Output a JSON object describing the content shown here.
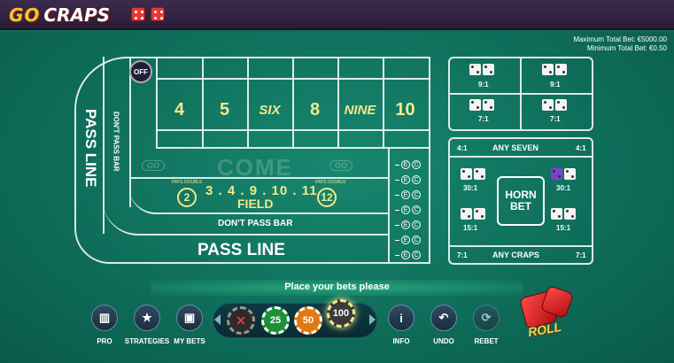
{
  "header": {
    "logo_go": "GO",
    "logo_craps": "CRAPS"
  },
  "limits": {
    "max_total_bet": "Maximum Total Bet: €5000.00",
    "min_total_bet": "Minimum Total Bet: €0.50"
  },
  "table": {
    "off_label": "OFF",
    "numbers": [
      "4",
      "5",
      "SIX",
      "8",
      "NINE",
      "10"
    ],
    "come_label": "COME",
    "go_badge": "GO",
    "field_numbers": "3 . 4 . 9 . 10 . 11 .",
    "field_label": "FIELD",
    "field_circle_left": "2",
    "field_circle_right": "12",
    "pays_double": "PAYS DOUBLE",
    "dont_pass_bar_h": "DON'T PASS BAR",
    "dont_pass_bar_v": "DON'T PASS BAR",
    "pass_line_h": "PASS LINE",
    "pass_line_v": "PASS LINE",
    "ec_e": "E",
    "ec_c": "C"
  },
  "props": {
    "hardways_odds": [
      "9:1",
      "9:1",
      "7:1",
      "7:1"
    ],
    "any_seven": "ANY SEVEN",
    "any_seven_odds_left": "4:1",
    "any_seven_odds_right": "4:1",
    "horn_bet": "HORN BET",
    "horn_odds": [
      "30:1",
      "30:1",
      "15:1",
      "15:1"
    ],
    "any_craps": "ANY CRAPS",
    "any_craps_odds_left": "7:1",
    "any_craps_odds_right": "7:1"
  },
  "status": {
    "message": "Place your bets please"
  },
  "controls": {
    "pro": "PRO",
    "strategies": "STRATEGIES",
    "my_bets": "MY BETS",
    "info": "INFO",
    "undo": "UNDO",
    "rebet": "REBET",
    "roll": "ROLL"
  },
  "chips": [
    {
      "label": "",
      "color": "#2b2b2b",
      "selected": false
    },
    {
      "label": "25",
      "color": "#1e8f3a",
      "selected": false
    },
    {
      "label": "50",
      "color": "#e07a12",
      "selected": false
    },
    {
      "label": "100",
      "color": "#3a3a3a",
      "selected": true
    }
  ],
  "colors": {
    "felt": "#0f6b5a",
    "number_text": "#f3e88a",
    "topbar": "#3d2a4d"
  }
}
